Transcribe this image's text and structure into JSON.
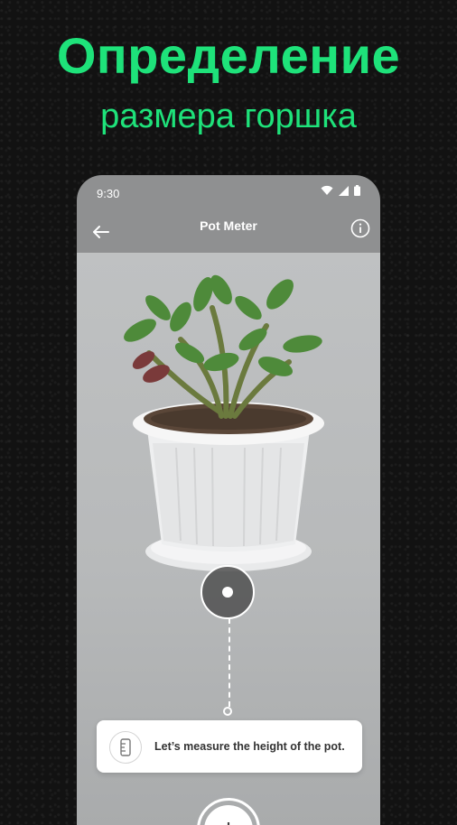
{
  "promo": {
    "title": "Определение",
    "subtitle": "размера горшка"
  },
  "status_bar": {
    "time": "9:30",
    "icons": [
      "wifi-icon",
      "signal-icon",
      "battery-icon"
    ]
  },
  "app_bar": {
    "title": "Pot Meter",
    "back_icon": "arrow-left-icon",
    "info_icon": "info-icon"
  },
  "camera": {
    "hint_text": "Let’s measure the height of the pot.",
    "hint_icon": "ruler-icon",
    "add_label": "+"
  },
  "colors": {
    "accent": "#1ee27a",
    "background": "#121212",
    "app_bar": "#8f9091"
  }
}
